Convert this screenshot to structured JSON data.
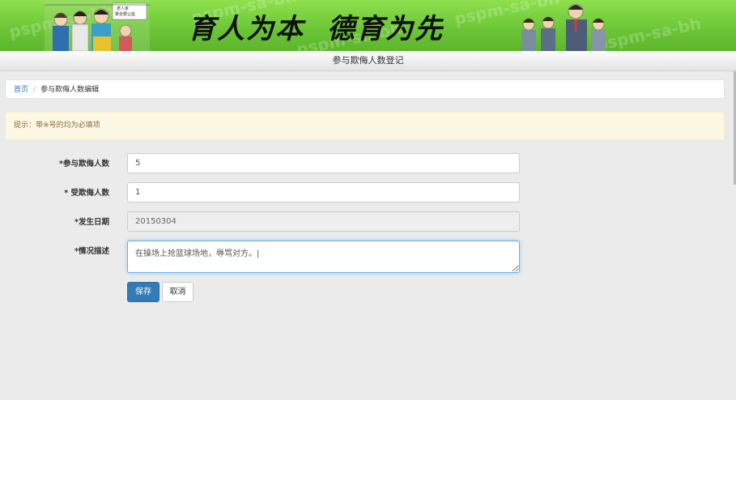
{
  "banner": {
    "slogan_part1": "育人为本",
    "slogan_part2": "德育为先",
    "watermark": "pspm-sa-bh",
    "sign_text": "老人家 乘坐要让座",
    "colors": {
      "green_top": "#8fe04e",
      "green_bottom": "#5db52c"
    }
  },
  "page_title": "参与欺侮人数登记",
  "breadcrumb": {
    "home": "首页",
    "separator": "/",
    "current": "参与欺侮人数编辑"
  },
  "notice": "提示：带※号的均为必填项",
  "form": {
    "participants": {
      "label": "*参与欺侮人数",
      "value": "5"
    },
    "victims": {
      "label": "* 受欺侮人数",
      "value": "1"
    },
    "date": {
      "label": "*发生日期",
      "value": "20150304"
    },
    "description": {
      "label": "*情况描述",
      "value": "在操场上抢篮球场地，辱骂对方。|"
    }
  },
  "buttons": {
    "save": "保存",
    "cancel": "取消"
  },
  "colors": {
    "primary": "#337ab7",
    "alert_bg": "#fcf8e3",
    "alert_text": "#8a6d3b",
    "content_bg": "#ebebeb"
  }
}
